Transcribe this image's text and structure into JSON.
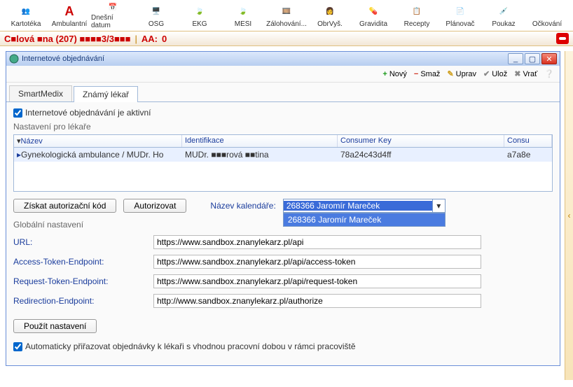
{
  "toolbar": [
    {
      "label": "Kartotéka",
      "icon": "👥"
    },
    {
      "label": "Ambulantní",
      "icon": "A",
      "style": "color:#c00;font-weight:700;font-size:18px"
    },
    {
      "label": "Dnešní datum",
      "icon": "📅"
    },
    {
      "label": "OSG",
      "icon": "🖥️"
    },
    {
      "label": "EKG",
      "icon": "🍃"
    },
    {
      "label": "MESI",
      "icon": "🍃"
    },
    {
      "label": "Zálohování...",
      "icon": "🎞️"
    },
    {
      "label": "ObrVyš.",
      "icon": "👩"
    },
    {
      "label": "Gravidita",
      "icon": "💊"
    },
    {
      "label": "Recepty",
      "icon": "📋"
    },
    {
      "label": "Plánovač",
      "icon": "📄"
    },
    {
      "label": "Poukaz",
      "icon": "💉"
    },
    {
      "label": "Očkování",
      "icon": ""
    }
  ],
  "status": {
    "patient": "C■lová ■na (207) ■■■■3/3■■■",
    "aa_label": "AA:",
    "aa_value": "0"
  },
  "win": {
    "title": "Internetové objednávání",
    "actions": [
      {
        "label": "Nový",
        "icon": "+",
        "color": "#1a9a1a"
      },
      {
        "label": "Smaž",
        "icon": "−",
        "color": "#d03020"
      },
      {
        "label": "Uprav",
        "icon": "✎",
        "color": "#d0a020"
      },
      {
        "label": "Ulož",
        "icon": "✔",
        "color": "#888"
      },
      {
        "label": "Vrať",
        "icon": "✖",
        "color": "#888"
      }
    ],
    "tabs": [
      "SmartMedix",
      "Známý lékař"
    ],
    "active_tab": 1,
    "checkbox_active": "Internetové objednávání je aktivní",
    "section1": "Nastavení pro lékaře",
    "grid": {
      "headers": [
        "Název",
        "Identifikace",
        "Consumer Key",
        "Consu"
      ],
      "row": [
        "Gynekologická ambulance / MUDr. Ho",
        "MUDr. ■■■rová ■■tina",
        "78a24c43d4ff",
        "a7a8e"
      ],
      "row_marker": "▸"
    },
    "buttons": {
      "auth_code": "Získat autorizační kód",
      "authorize": "Autorizovat",
      "apply": "Použít nastavení"
    },
    "calendar": {
      "label": "Název kalendáře:",
      "selected": "268366  Jaromír Mareček",
      "options": [
        "268366  Jaromír Mareček"
      ]
    },
    "section2": "Globální nastavení",
    "fields": [
      {
        "label": "URL:",
        "value": "https://www.sandbox.znanylekarz.pl/api"
      },
      {
        "label": "Access-Token-Endpoint:",
        "value": "https://www.sandbox.znanylekarz.pl/api/access-token"
      },
      {
        "label": "Request-Token-Endpoint:",
        "value": "https://www.sandbox.znanylekarz.pl/api/request-token"
      },
      {
        "label": "Redirection-Endpoint:",
        "value": "http://www.sandbox.znanylekarz.pl/authorize"
      }
    ],
    "checkbox_auto": "Automaticky přiřazovat objednávky k lékaři s vhodnou pracovní dobou v rámci pracoviště"
  }
}
